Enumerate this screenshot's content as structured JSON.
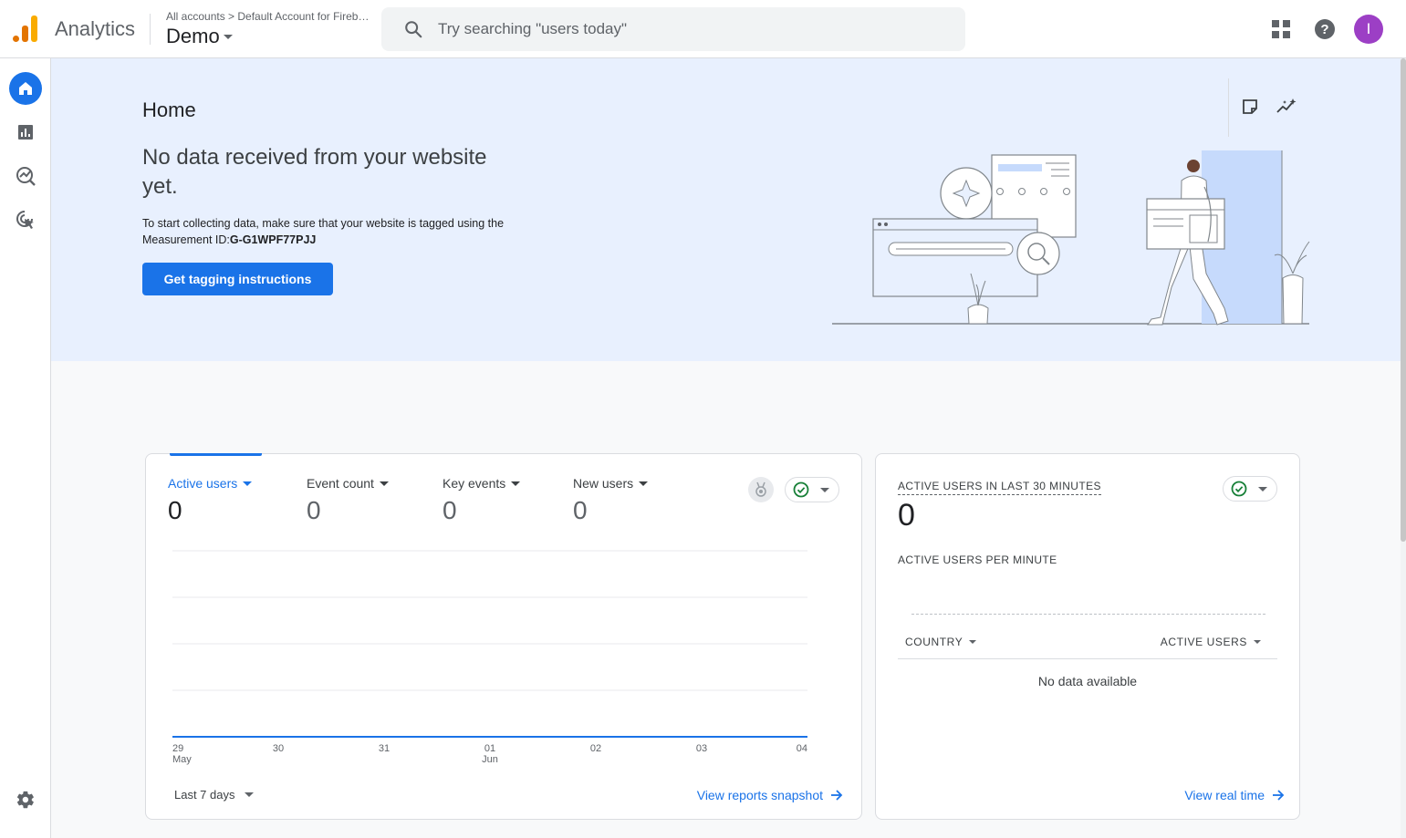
{
  "app": {
    "title": "Analytics"
  },
  "account": {
    "breadcrumb": "All accounts > Default Account for Firebase",
    "property_name": "Demo"
  },
  "search": {
    "placeholder": "Try searching \"users today\""
  },
  "user": {
    "avatar_initial": "I",
    "avatar_color": "#9c3fc5"
  },
  "icons": {
    "top": [
      "apps-grid-icon",
      "help-icon"
    ],
    "nav": [
      "home-icon",
      "reports-icon",
      "explore-icon",
      "advertising-icon",
      "settings-icon"
    ],
    "hero_tools": [
      "notes-icon",
      "insights-icon"
    ]
  },
  "colors": {
    "accent": "#1a73e8",
    "hero_bg": "#e8f0fe",
    "success": "#188038"
  },
  "hero": {
    "page_title": "Home",
    "heading": "No data received from your website yet.",
    "desc_prefix": "To start collecting data, make sure that your website is tagged using the Measurement ID:",
    "measurement_id": "G-G1WPF77PJJ",
    "cta_label": "Get tagging instructions"
  },
  "overview": {
    "metrics": [
      {
        "label": "Active users",
        "value": "0"
      },
      {
        "label": "Event count",
        "value": "0"
      },
      {
        "label": "Key events",
        "value": "0"
      },
      {
        "label": "New users",
        "value": "0"
      }
    ],
    "date_range": "Last 7 days",
    "link_label": "View reports snapshot"
  },
  "chart_data": {
    "type": "line",
    "x": [
      {
        "day": "29",
        "month": "May"
      },
      {
        "day": "30",
        "month": ""
      },
      {
        "day": "31",
        "month": ""
      },
      {
        "day": "01",
        "month": "Jun"
      },
      {
        "day": "02",
        "month": ""
      },
      {
        "day": "03",
        "month": ""
      },
      {
        "day": "04",
        "month": ""
      }
    ],
    "series": [
      {
        "values": [
          0,
          0,
          0,
          0,
          0,
          0,
          0
        ]
      }
    ],
    "grid": true,
    "color": "#1a73e8"
  },
  "realtime": {
    "title": "ACTIVE USERS IN LAST 30 MINUTES",
    "value": "0",
    "per_minute_label": "ACTIVE USERS PER MINUTE",
    "table": {
      "col_country": "COUNTRY",
      "col_active_users": "ACTIVE USERS",
      "empty_text": "No data available"
    },
    "link_label": "View real time"
  }
}
